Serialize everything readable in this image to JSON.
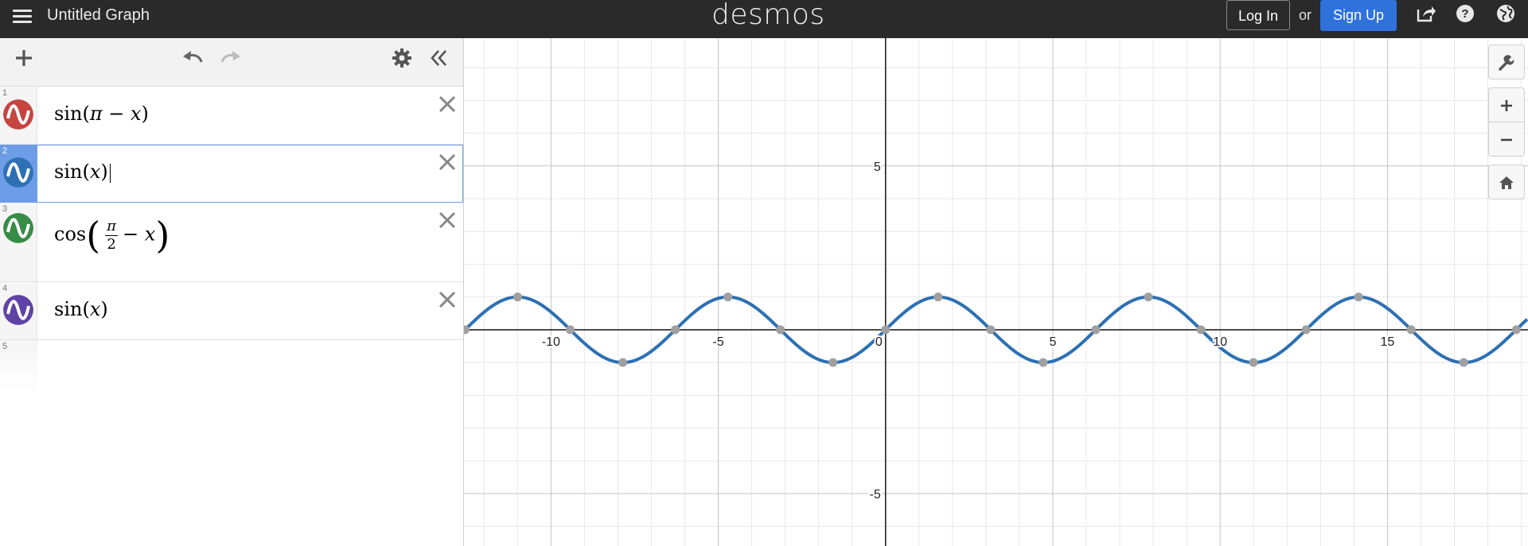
{
  "header": {
    "title": "Untitled Graph",
    "logo": "desmos",
    "login_label": "Log In",
    "or_label": "or",
    "signup_label": "Sign Up",
    "icons": [
      "hamburger-icon",
      "share-icon",
      "help-icon",
      "globe-icon"
    ]
  },
  "toolbar": {
    "icons": [
      "add-icon",
      "undo-icon",
      "redo-icon",
      "settings-icon",
      "collapse-icon"
    ]
  },
  "expressions": [
    {
      "num": "1",
      "latex": "sin(π − x)",
      "color": "#c74440",
      "selected": false
    },
    {
      "num": "2",
      "latex": "sin(x)",
      "color": "#2d70b3",
      "selected": true
    },
    {
      "num": "3",
      "latex": "cos(π/2 − x)",
      "color": "#388c46",
      "selected": false
    },
    {
      "num": "4",
      "latex": "sin(x)",
      "color": "#6042a6",
      "selected": false
    },
    {
      "num": "5",
      "latex": "",
      "color": "",
      "selected": false
    }
  ],
  "graph": {
    "x_ticks": [
      "-10",
      "-5",
      "0",
      "5",
      "10",
      "15"
    ],
    "y_ticks": [
      "5",
      "-5"
    ],
    "curve_color": "#2d70b3",
    "point_color": "#a0a0a0",
    "xlim": [
      -12.6,
      19.2
    ],
    "ylim": [
      -6.6,
      8.9
    ]
  },
  "side_tools": {
    "icons": [
      "wrench-icon",
      "zoom-in-icon",
      "zoom-out-icon",
      "home-icon"
    ]
  }
}
